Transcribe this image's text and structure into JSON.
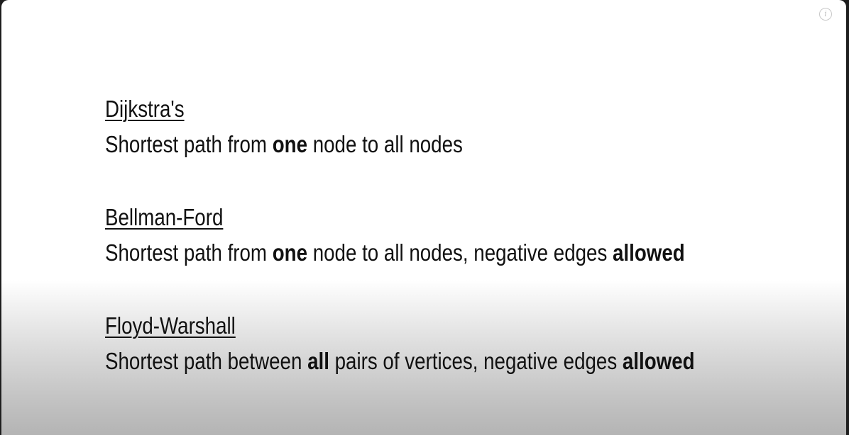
{
  "info_icon": {
    "glyph": "i",
    "name": "info-icon"
  },
  "algorithms": [
    {
      "title": "Dijkstra's",
      "desc_1": "Shortest path from ",
      "desc_bold_1": "one",
      "desc_2": " node to all nodes",
      "desc_bold_2": "",
      "desc_3": ""
    },
    {
      "title": "Bellman-Ford",
      "desc_1": "Shortest path from ",
      "desc_bold_1": "one",
      "desc_2": " node to all nodes, negative edges ",
      "desc_bold_2": "allowed",
      "desc_3": ""
    },
    {
      "title": "Floyd-Warshall",
      "desc_1": "Shortest path between ",
      "desc_bold_1": "all",
      "desc_2": " pairs of vertices, negative edges ",
      "desc_bold_2": "allowed",
      "desc_3": ""
    }
  ],
  "colors": {
    "text": "#111111",
    "background": "#ffffff",
    "gradient_bottom": "#b4b4b4"
  }
}
